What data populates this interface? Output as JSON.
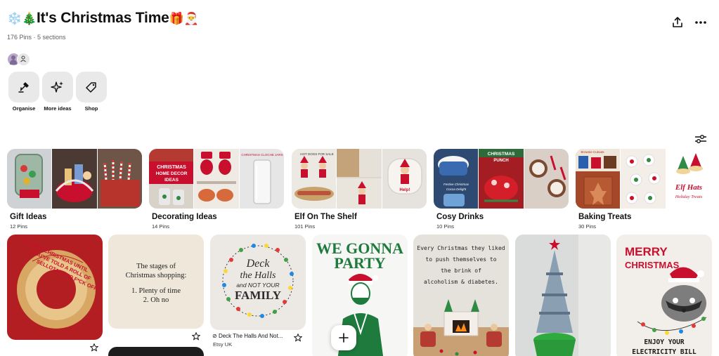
{
  "board": {
    "emoji_prefix": "❄️🎄",
    "title": "It's Christmas Time",
    "emoji_suffix": "🎁🎅",
    "meta": "176 Pins · 5 sections"
  },
  "toolbar": [
    {
      "label": "Organise",
      "icon": "organise-icon"
    },
    {
      "label": "More ideas",
      "icon": "sparkle-icon"
    },
    {
      "label": "Shop",
      "icon": "tag-icon"
    }
  ],
  "sections": [
    {
      "name": "Gift Ideas",
      "count": "12 Pins"
    },
    {
      "name": "Decorating Ideas",
      "count": "14 Pins",
      "tile_text": "CHRISTMAS HOME DECOR IDEAS"
    },
    {
      "name": "Elf On The Shelf",
      "count": "101 Pins"
    },
    {
      "name": "Cosy Drinks",
      "count": "10 Pins",
      "tile_text": "CHRISTMAS PUNCH"
    },
    {
      "name": "Baking Treats",
      "count": "30 Pins",
      "tile_text": "Elf Hats Holiday Treats"
    }
  ],
  "pins": [
    {
      "image_text": "IT'S NOT CHRISTMAS UNTIL YOU'VE TOLD A ROLL OF SELLOTAPE TO F*CK OFF"
    },
    {
      "line1": "The stages of",
      "line2": "Christmas shopping:",
      "line3": "1. Plenty of time",
      "line4": "2. Oh no"
    },
    {
      "line1": "Deck",
      "line2": "the Halls",
      "line3": "and NOT YOUR",
      "line4": "FAMILY",
      "title": "Deck The Halls And Not...",
      "source": "Etsy UK"
    },
    {
      "line1": "WE GONNA",
      "line2": "PARTY"
    },
    {
      "line1": "Every Christmas they liked",
      "line2": "to push themselves to",
      "line3": "the brink of",
      "line4": "alcoholism & diabetes."
    },
    {},
    {
      "line1": "MERRY",
      "line2": "CHRISTMAS",
      "line3": "ENJOY YOUR",
      "line4": "ELECTRICITY BILL"
    }
  ],
  "colors": {
    "tool_bg": "#e9e9e9",
    "text": "#111111",
    "muted": "#5f5f5f",
    "christmas_red": "#c8102e",
    "christmas_green": "#1f7a3a"
  }
}
